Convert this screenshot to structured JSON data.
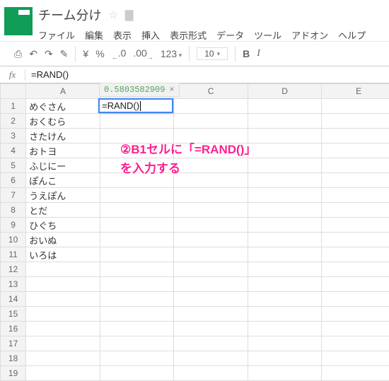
{
  "header": {
    "doc_title": "チーム分け",
    "menus": [
      "ファイル",
      "編集",
      "表示",
      "挿入",
      "表示形式",
      "データ",
      "ツール",
      "アドオン",
      "ヘルプ"
    ]
  },
  "toolbar": {
    "dec_precision": ".0",
    "inc_precision": ".00",
    "number_format": "123",
    "font_size": "10",
    "bold": "B",
    "italic": "I"
  },
  "formula_bar": {
    "fx": "fx",
    "value": "=RAND()"
  },
  "grid": {
    "columns": [
      "A",
      "B",
      "C",
      "D",
      "E"
    ],
    "rows": [
      {
        "num": "1",
        "A": "めぐさん"
      },
      {
        "num": "2",
        "A": "おくむら"
      },
      {
        "num": "3",
        "A": "さたけん"
      },
      {
        "num": "4",
        "A": "おトヨ"
      },
      {
        "num": "5",
        "A": "ふじにー"
      },
      {
        "num": "6",
        "A": "ぽんこ"
      },
      {
        "num": "7",
        "A": "うえぽん"
      },
      {
        "num": "8",
        "A": "とだ"
      },
      {
        "num": "9",
        "A": "ひぐち"
      },
      {
        "num": "10",
        "A": "おいぬ"
      },
      {
        "num": "11",
        "A": "いろは"
      },
      {
        "num": "12",
        "A": ""
      },
      {
        "num": "13",
        "A": ""
      },
      {
        "num": "14",
        "A": ""
      },
      {
        "num": "15",
        "A": ""
      },
      {
        "num": "16",
        "A": ""
      },
      {
        "num": "17",
        "A": ""
      },
      {
        "num": "18",
        "A": ""
      },
      {
        "num": "19",
        "A": ""
      }
    ]
  },
  "active_cell": {
    "ref": "B1",
    "display": "=RAND()",
    "tooltip_value": "0.5803582909",
    "tooltip_close": "×"
  },
  "annotation": {
    "line1": "②B1セルに「=RAND()」",
    "line2": "を入力する"
  }
}
